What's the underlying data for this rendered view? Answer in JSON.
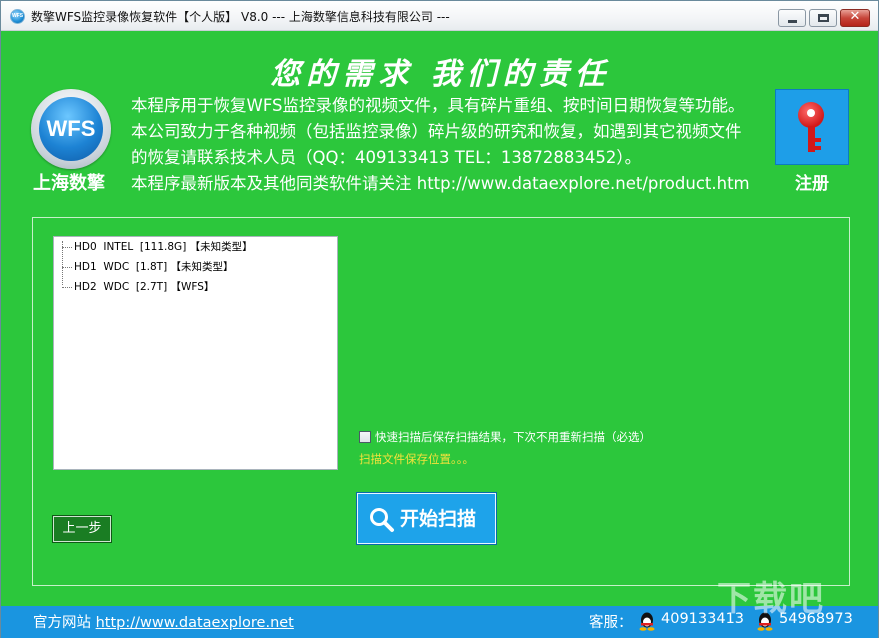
{
  "window": {
    "title": "数擎WFS监控录像恢复软件【个人版】 V8.0  --- 上海数擎信息科技有限公司 ---",
    "icon_text": "WFS"
  },
  "header": {
    "slogan": "您的需求   我们的责任",
    "logo_text": "WFS",
    "logo_label": "上海数擎",
    "intro_lines": [
      "本程序用于恢复WFS监控录像的视频文件，具有碎片重组、按时间日期恢复等功能。",
      "本公司致力于各种视频（包括监控录像）碎片级的研究和恢复，如遇到其它视频文件",
      "的恢复请联系技术人员（QQ：409133413  TEL：13872883452）。",
      "本程序最新版本及其他同类软件请关注 http://www.dataexplore.net/product.htm"
    ],
    "register_label": "注册"
  },
  "drives": [
    {
      "id": "HD0",
      "model": "INTEL",
      "size": "[111.8G]",
      "type": "【未知类型】"
    },
    {
      "id": "HD1",
      "model": "WDC",
      "size": "[1.8T]",
      "type": "【未知类型】"
    },
    {
      "id": "HD2",
      "model": "WDC",
      "size": "[2.7T]",
      "type": "【WFS】"
    }
  ],
  "options": {
    "save_scan_label": "快速扫描后保存扫描结果，下次不用重新扫描（必选）",
    "save_scan_checked": false,
    "save_path_text": "扫描文件保存位置。。。"
  },
  "buttons": {
    "prev_label": "上一步",
    "scan_label": "开始扫描"
  },
  "footer": {
    "site_prefix": "官方网站",
    "site_url": "http://www.dataexplore.net",
    "service_label": "客服：",
    "qq1": "409133413",
    "qq2": "54968973"
  },
  "watermark": "下载吧",
  "colors": {
    "background": "#2cc73c",
    "accent_blue": "#1ea3ea",
    "path_text": "#f3e23b",
    "key_red": "#d11919"
  },
  "icons": [
    "app-icon",
    "wfs-logo",
    "key-icon",
    "search-icon",
    "qq-icon"
  ]
}
